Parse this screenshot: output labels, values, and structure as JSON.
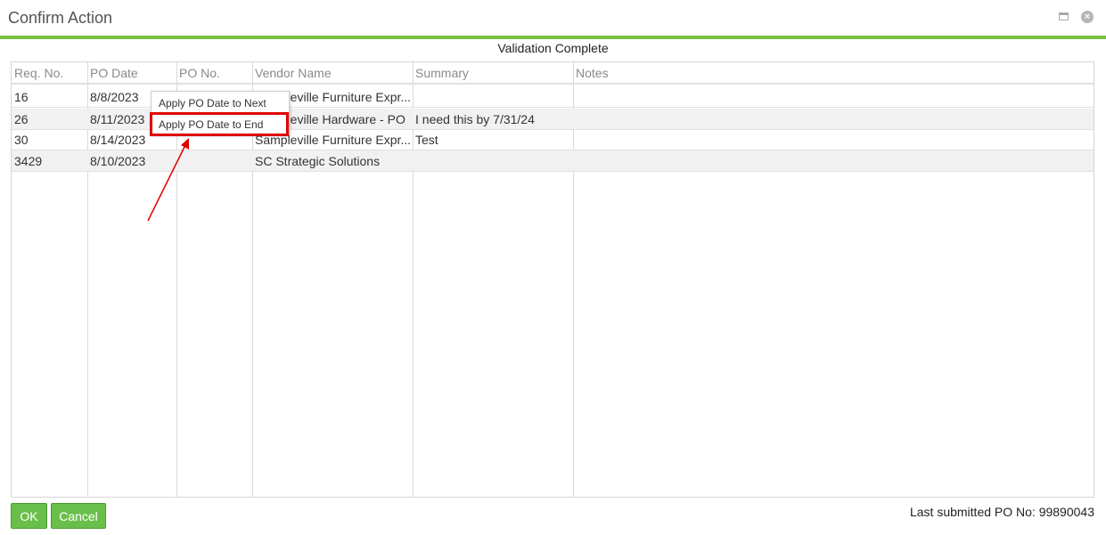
{
  "window": {
    "title": "Confirm Action"
  },
  "subtitle": "Validation Complete",
  "table": {
    "columns": [
      "Req. No.",
      "PO Date",
      "PO No.",
      "Vendor Name",
      "Summary",
      "Notes"
    ],
    "rows": [
      {
        "req": "16",
        "po_date": "8/8/2023",
        "po_no": "",
        "vendor": "Sampleville Furniture Expr...",
        "summary": "",
        "notes": ""
      },
      {
        "req": "26",
        "po_date": "8/11/2023",
        "po_no": "",
        "vendor": "Sampleville Hardware - PO",
        "summary": "I need this by 7/31/24",
        "notes": ""
      },
      {
        "req": "30",
        "po_date": "8/14/2023",
        "po_no": "",
        "vendor": "Sampleville Furniture Expr...",
        "summary": "Test",
        "notes": ""
      },
      {
        "req": "3429",
        "po_date": "8/10/2023",
        "po_no": "",
        "vendor": "SC Strategic Solutions",
        "summary": "",
        "notes": ""
      }
    ]
  },
  "context_menu": {
    "items": [
      "Apply PO Date to Next",
      "Apply PO Date to End"
    ],
    "highlighted_index": 1
  },
  "buttons": {
    "ok": "OK",
    "cancel": "Cancel"
  },
  "footer": {
    "last_submitted": "Last submitted PO No: 99890043"
  },
  "colors": {
    "accent": "#7ac142",
    "button": "#6abf4b",
    "highlight": "#e00000"
  },
  "icons": [
    "maximize-icon",
    "close-icon"
  ]
}
